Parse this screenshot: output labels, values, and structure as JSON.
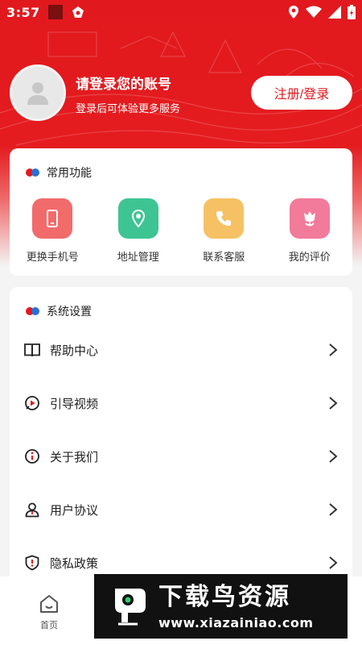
{
  "status_bar": {
    "time": "3:57"
  },
  "profile": {
    "title": "请登录您的账号",
    "subtitle": "登录后可体验更多服务",
    "login_button": "注册/登录"
  },
  "functions": {
    "title": "常用功能",
    "items": [
      {
        "label": "更换手机号",
        "icon": "phone-icon",
        "color": "#f26b6b"
      },
      {
        "label": "地址管理",
        "icon": "location-pin-icon",
        "color": "#3ec493"
      },
      {
        "label": "联系客服",
        "icon": "telephone-icon",
        "color": "#f6c164"
      },
      {
        "label": "我的评价",
        "icon": "flower-icon",
        "color": "#f27a9b"
      }
    ]
  },
  "system": {
    "title": "系统设置",
    "items": [
      {
        "label": "帮助中心",
        "icon": "book-icon"
      },
      {
        "label": "引导视频",
        "icon": "video-play-icon"
      },
      {
        "label": "关于我们",
        "icon": "info-icon"
      },
      {
        "label": "用户协议",
        "icon": "user-icon"
      },
      {
        "label": "隐私政策",
        "icon": "shield-icon"
      }
    ]
  },
  "tabbar": {
    "home_label": "首页"
  },
  "watermark": {
    "title": "下载鸟资源",
    "url": "www.xiazainiao.com"
  },
  "colors": {
    "brand_red": "#e1191e",
    "accent_blue": "#2a6fd6"
  }
}
